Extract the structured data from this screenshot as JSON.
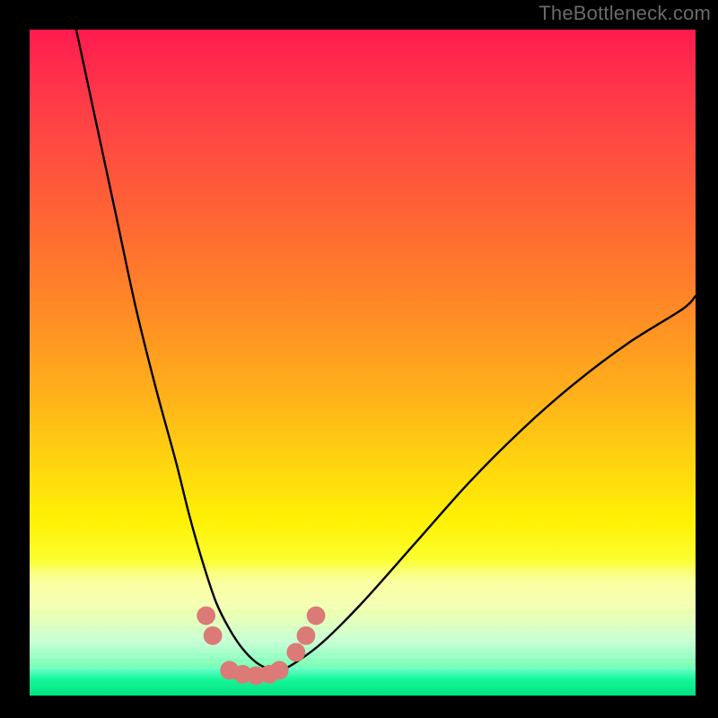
{
  "watermark": "TheBottleneck.com",
  "chart_data": {
    "type": "line",
    "title": "",
    "xlabel": "",
    "ylabel": "",
    "xlim": [
      0,
      100
    ],
    "ylim": [
      0,
      100
    ],
    "grid": false,
    "legend": false,
    "background": {
      "gradient": "red-to-green vertical",
      "stops": [
        {
          "pos": 0,
          "color": "#ff1b4f"
        },
        {
          "pos": 50,
          "color": "#ffb11a"
        },
        {
          "pos": 75,
          "color": "#fff205"
        },
        {
          "pos": 100,
          "color": "#00e37f"
        }
      ]
    },
    "series": [
      {
        "name": "bottleneck-curve",
        "color": "#000000",
        "x": [
          7,
          10,
          13,
          16,
          19,
          22,
          24,
          26,
          28,
          30,
          32,
          34,
          36,
          38,
          40,
          44,
          50,
          58,
          66,
          74,
          82,
          90,
          98,
          100
        ],
        "y": [
          100,
          86,
          72,
          58,
          46,
          35,
          27,
          20,
          14,
          10,
          7,
          5,
          4,
          4,
          5,
          8,
          14,
          23,
          32,
          40,
          47,
          53,
          58,
          60
        ]
      }
    ],
    "markers": {
      "name": "highlighted-points",
      "color": "#db7a77",
      "radius_pct": 1.4,
      "points": [
        {
          "x": 26.5,
          "y": 12
        },
        {
          "x": 27.5,
          "y": 9
        },
        {
          "x": 30.0,
          "y": 3.8
        },
        {
          "x": 32.0,
          "y": 3.2
        },
        {
          "x": 34.0,
          "y": 3.0
        },
        {
          "x": 36.0,
          "y": 3.2
        },
        {
          "x": 37.5,
          "y": 3.8
        },
        {
          "x": 40.0,
          "y": 6.5
        },
        {
          "x": 41.5,
          "y": 9.0
        },
        {
          "x": 43.0,
          "y": 12.0
        }
      ]
    }
  }
}
